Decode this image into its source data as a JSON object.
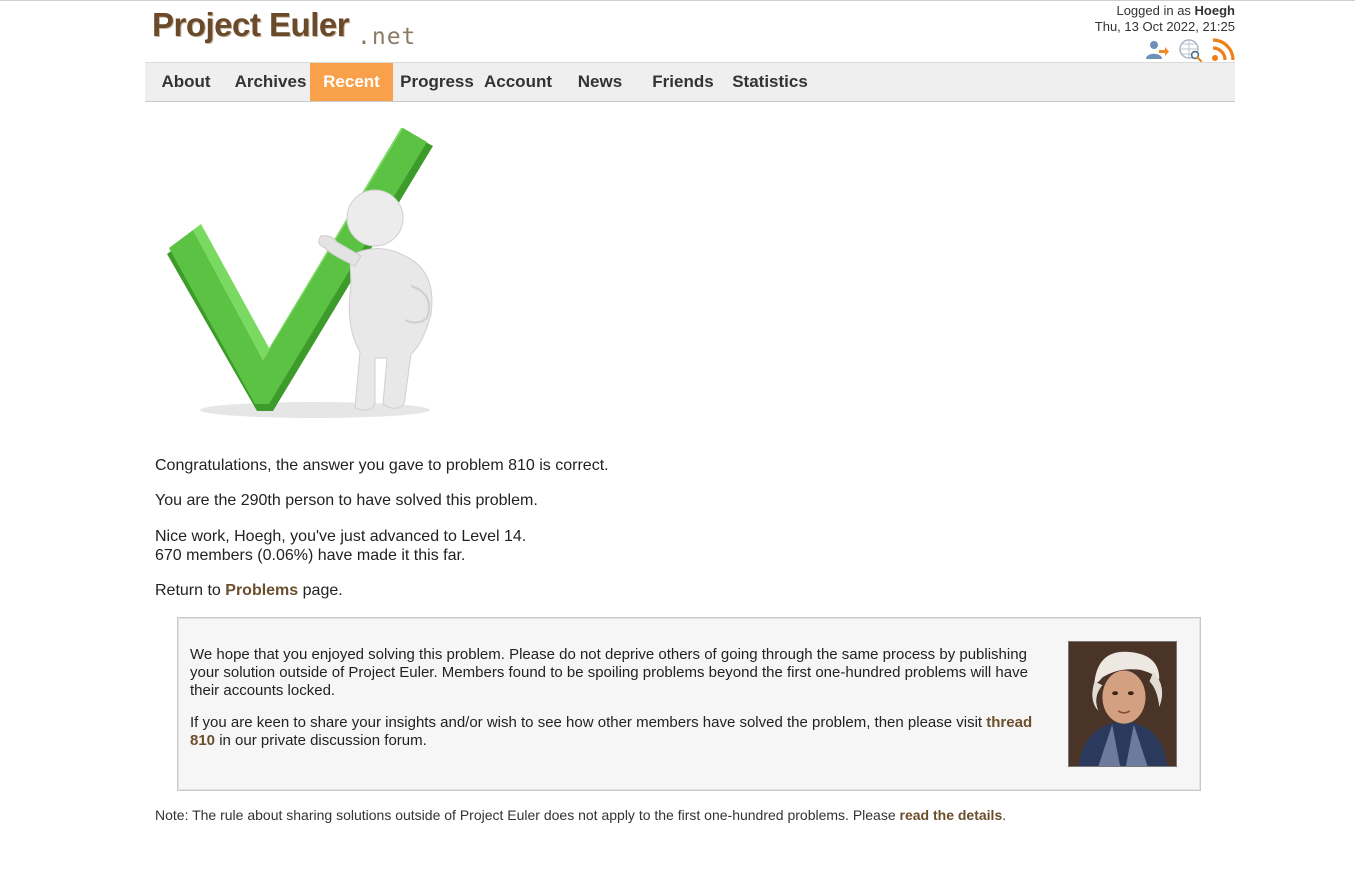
{
  "header": {
    "logo": {
      "main": "Project Euler",
      "suffix": ".net"
    },
    "logged_in_prefix": "Logged in as",
    "username": "Hoegh",
    "datetime": "Thu, 13 Oct 2022, 21:25",
    "icons": [
      "sign-out-icon",
      "search-icon",
      "rss-feed-icon"
    ]
  },
  "nav": {
    "items": [
      {
        "label": "About"
      },
      {
        "label": "Archives"
      },
      {
        "label": "Recent",
        "active": true
      },
      {
        "label": "Progress"
      },
      {
        "label": "Account"
      },
      {
        "label": "News"
      },
      {
        "label": "Friends"
      },
      {
        "label": "Statistics"
      }
    ]
  },
  "result": {
    "correct": "Congratulations, the answer you gave to problem 810 is correct.",
    "solver_rank": "You are the 290th person to have solved this problem.",
    "level_line": "Nice work, Hoegh, you've just advanced to Level 14.",
    "members_line": "670 members (0.06%) have made it this far.",
    "return_prefix": "Return to",
    "return_link": "Problems",
    "return_suffix": "page."
  },
  "notice": {
    "p1": "We hope that you enjoyed solving this problem. Please do not deprive others of going through the same process by publishing your solution outside of Project Euler. Members found to be spoiling problems beyond the first one-hundred problems will have their accounts locked.",
    "p2_prefix": "If you are keen to share your insights and/or wish to see how other members have solved the problem, then please visit",
    "p2_link": "thread 810",
    "p2_suffix": "in our private discussion forum."
  },
  "footer_note": {
    "text": "Note: The rule about sharing solutions outside of Project Euler does not apply to the first one-hundred problems. Please",
    "link": "read the details",
    "end": "."
  },
  "colors": {
    "accent": "#f9a04a",
    "link": "#6b4f2c",
    "nav_bg": "#efefef",
    "check_green": "#4db23a"
  }
}
